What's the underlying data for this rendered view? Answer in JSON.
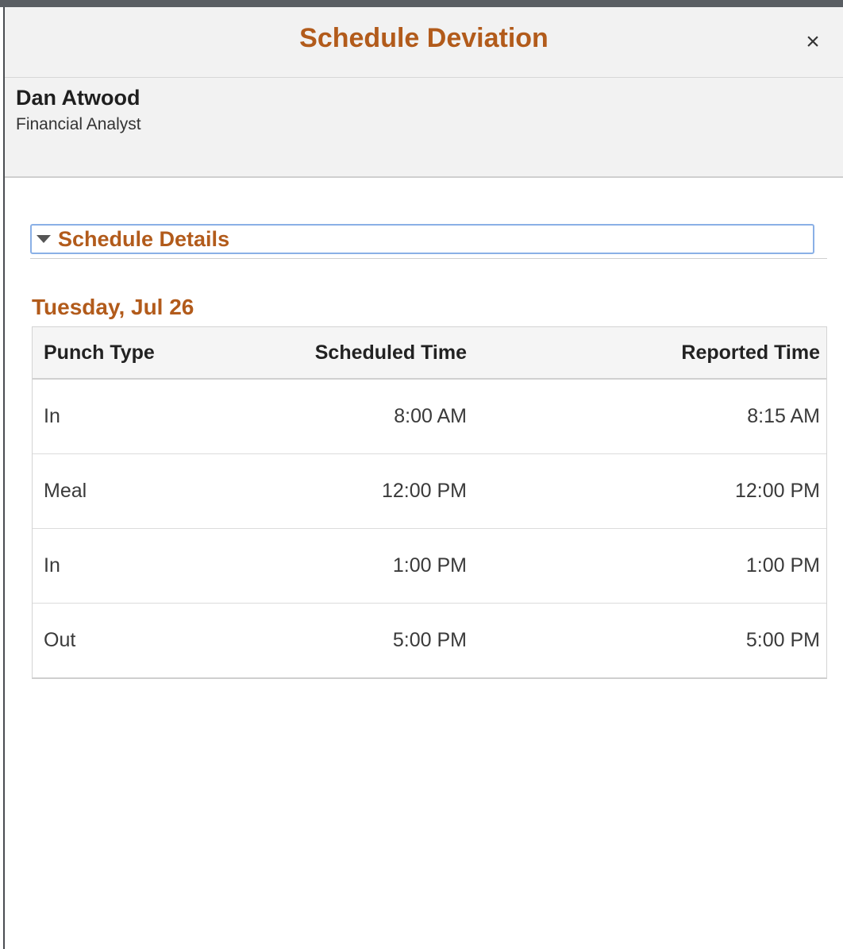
{
  "modal": {
    "title": "Schedule Deviation",
    "close_glyph": "×",
    "close_icon": "close-icon"
  },
  "person": {
    "name": "Dan Atwood",
    "job_title": "Financial Analyst"
  },
  "section": {
    "title": "Schedule Details",
    "expanded": true,
    "caret_icon": "caret-down-icon"
  },
  "day": {
    "label": "Tuesday, Jul 26"
  },
  "table": {
    "headers": {
      "punch_type": "Punch Type",
      "scheduled_time": "Scheduled Time",
      "reported_time": "Reported Time"
    },
    "rows": [
      {
        "punch_type": "In",
        "scheduled_time": "8:00 AM",
        "reported_time": "8:15 AM"
      },
      {
        "punch_type": "Meal",
        "scheduled_time": "12:00 PM",
        "reported_time": "12:00 PM"
      },
      {
        "punch_type": "In",
        "scheduled_time": "1:00 PM",
        "reported_time": "1:00 PM"
      },
      {
        "punch_type": "Out",
        "scheduled_time": "5:00 PM",
        "reported_time": "5:00 PM"
      }
    ]
  },
  "colors": {
    "accent": "#b25b1b",
    "header_bg": "#f2f2f2",
    "focus_border": "#8ab0e6"
  }
}
